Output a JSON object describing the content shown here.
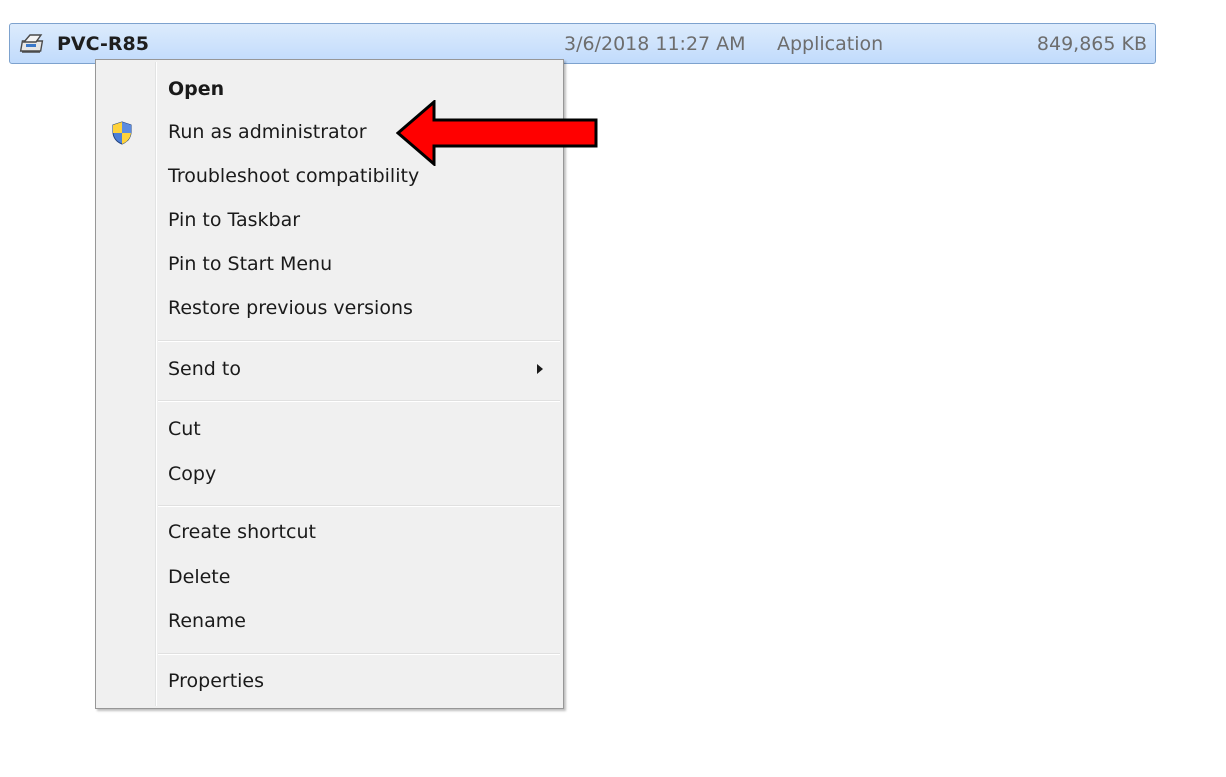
{
  "file_row": {
    "name": "PVC-R85",
    "date": "3/6/2018 11:27 AM",
    "type": "Application",
    "size": "849,865 KB",
    "icon": "application-icon"
  },
  "context_menu": {
    "items": [
      {
        "label": "Open",
        "bold": true,
        "mnemonic": "O"
      },
      {
        "label": "Run as administrator",
        "icon": "uac-shield-icon",
        "mnemonic": "a"
      },
      {
        "label": "Troubleshoot compatibility",
        "mnemonic": "y"
      },
      {
        "label": "Pin to Taskbar",
        "mnemonic": "k"
      },
      {
        "label": "Pin to Start Menu",
        "mnemonic": "u"
      },
      {
        "label": "Restore previous versions",
        "mnemonic": "v"
      },
      {
        "label": "Send to",
        "submenu": true,
        "mnemonic": "n"
      },
      {
        "label": "Cut",
        "mnemonic": "t"
      },
      {
        "label": "Copy",
        "mnemonic": "C"
      },
      {
        "label": "Create shortcut",
        "mnemonic": "s"
      },
      {
        "label": "Delete",
        "mnemonic": "D"
      },
      {
        "label": "Rename",
        "mnemonic": "m"
      },
      {
        "label": "Properties",
        "mnemonic": "r"
      }
    ]
  },
  "colors": {
    "selection": "#cce4fc",
    "annotation_arrow": "#ff0000"
  }
}
